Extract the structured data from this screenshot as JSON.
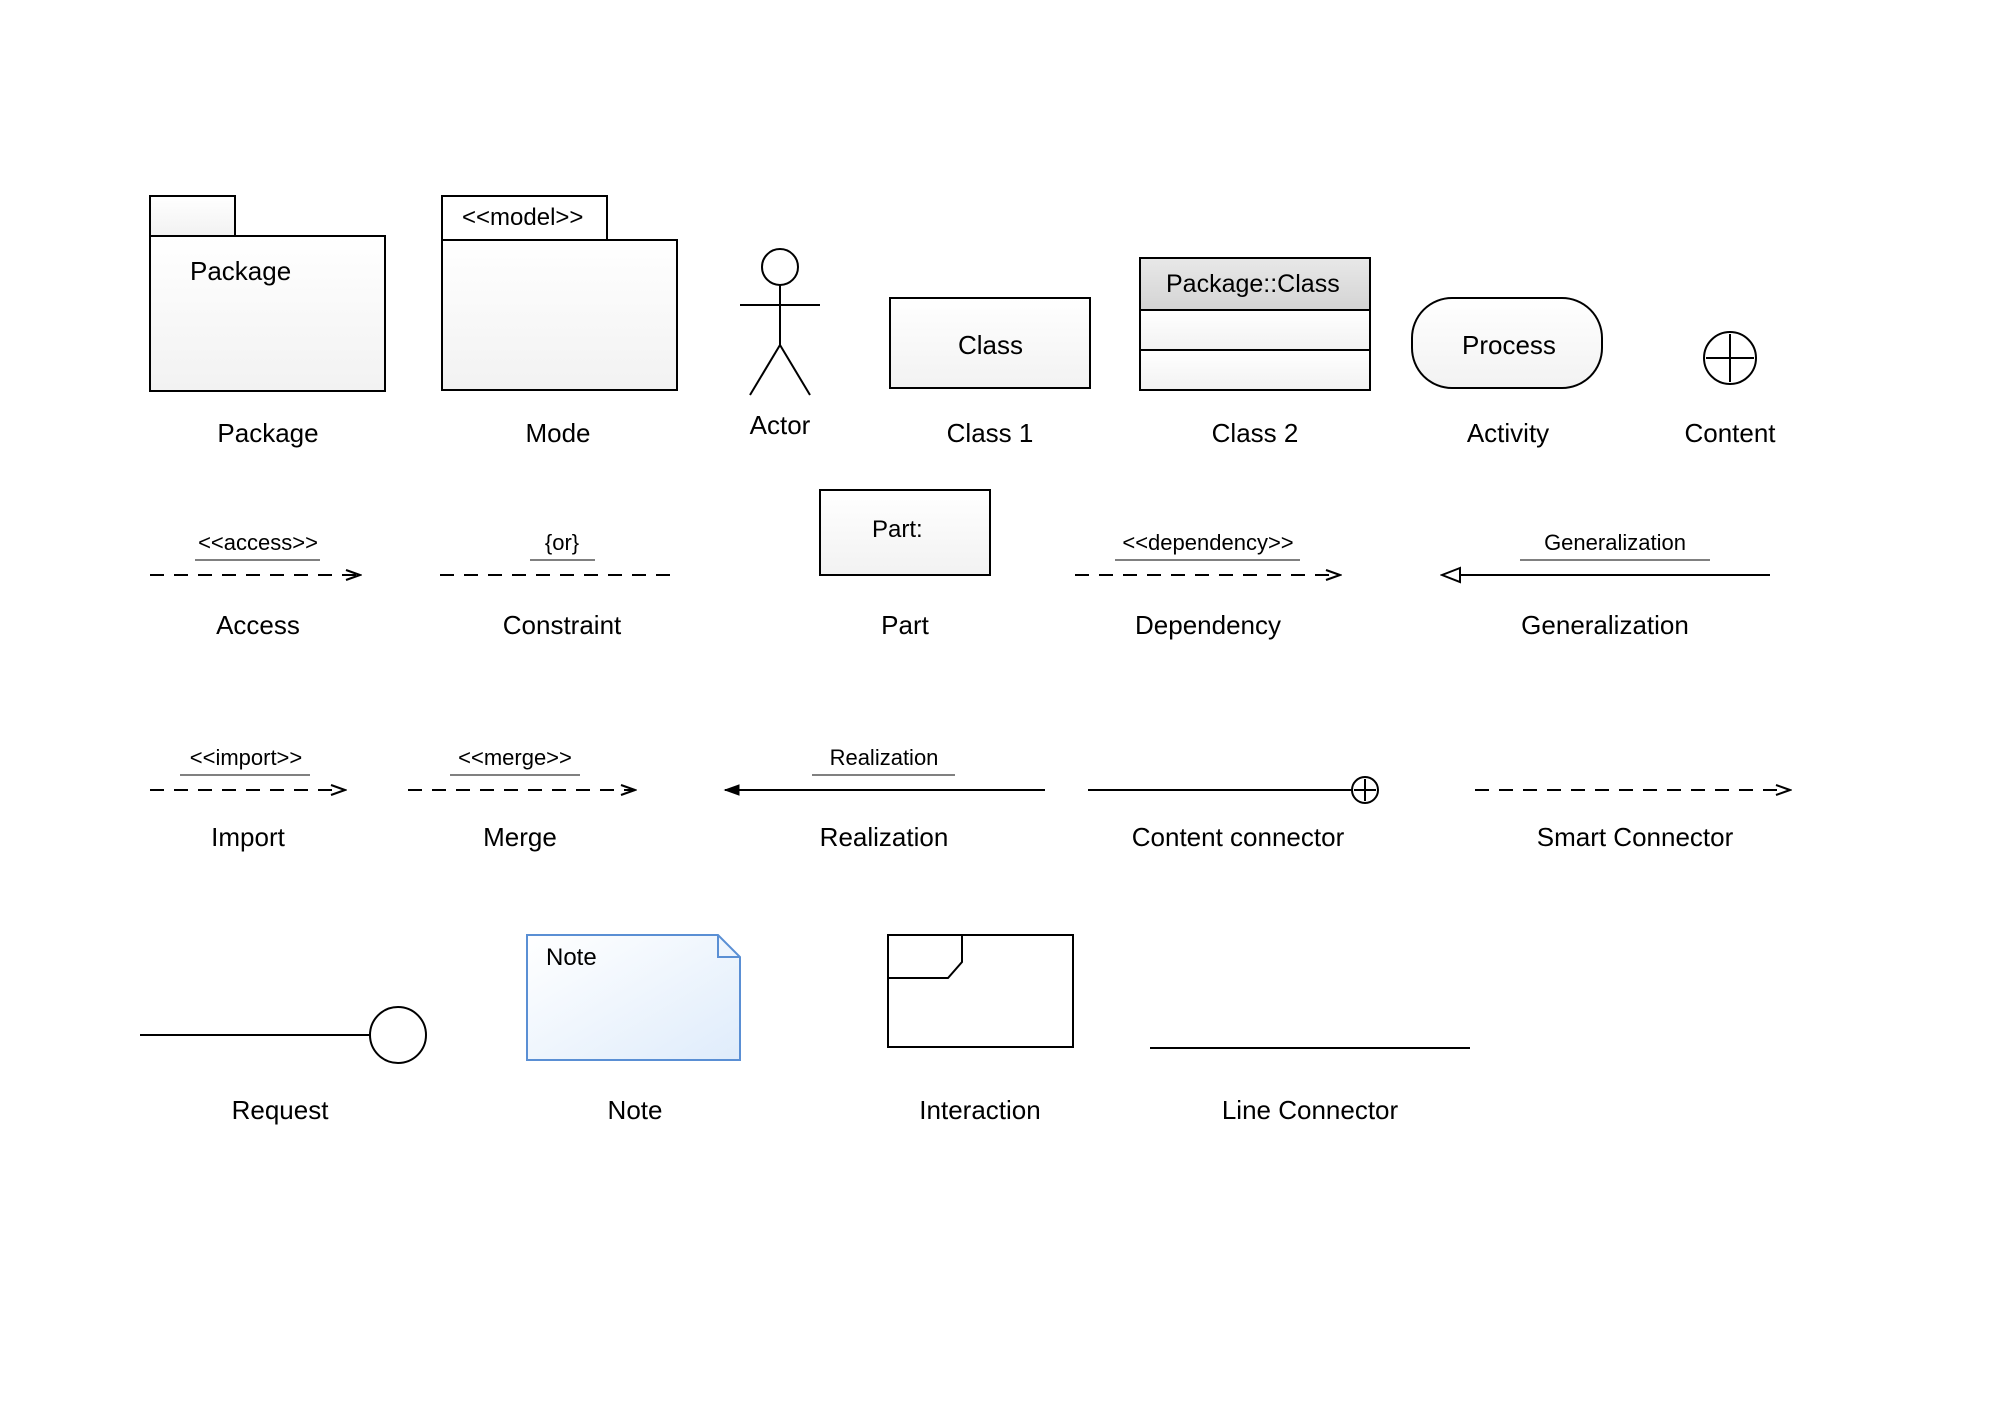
{
  "row1": {
    "package": {
      "inside": "Package",
      "caption": "Package"
    },
    "mode": {
      "inside": "<<model>>",
      "caption": "Mode"
    },
    "actor": {
      "caption": "Actor"
    },
    "class1": {
      "inside": "Class",
      "caption": "Class 1"
    },
    "class2": {
      "inside": "Package::Class",
      "caption": "Class 2"
    },
    "activity": {
      "inside": "Process",
      "caption": "Activity"
    },
    "content": {
      "caption": "Content"
    }
  },
  "row2": {
    "access": {
      "text": "<<access>>",
      "caption": "Access"
    },
    "constraint": {
      "text": "{or}",
      "caption": "Constraint"
    },
    "part": {
      "inside": "Part:",
      "caption": "Part"
    },
    "dependency": {
      "text": "<<dependency>>",
      "caption": "Dependency"
    },
    "generalization": {
      "text": "Generalization",
      "caption": "Generalization"
    }
  },
  "row3": {
    "import": {
      "text": "<<import>>",
      "caption": "Import"
    },
    "merge": {
      "text": "<<merge>>",
      "caption": "Merge"
    },
    "realization": {
      "text": "Realization",
      "caption": "Realization"
    },
    "content_connector": {
      "caption": "Content connector"
    },
    "smart_connector": {
      "caption": "Smart Connector"
    }
  },
  "row4": {
    "request": {
      "caption": "Request"
    },
    "note": {
      "inside": "Note",
      "caption": "Note"
    },
    "interaction": {
      "caption": "Interaction"
    },
    "line_connector": {
      "caption": "Line Connector"
    }
  }
}
